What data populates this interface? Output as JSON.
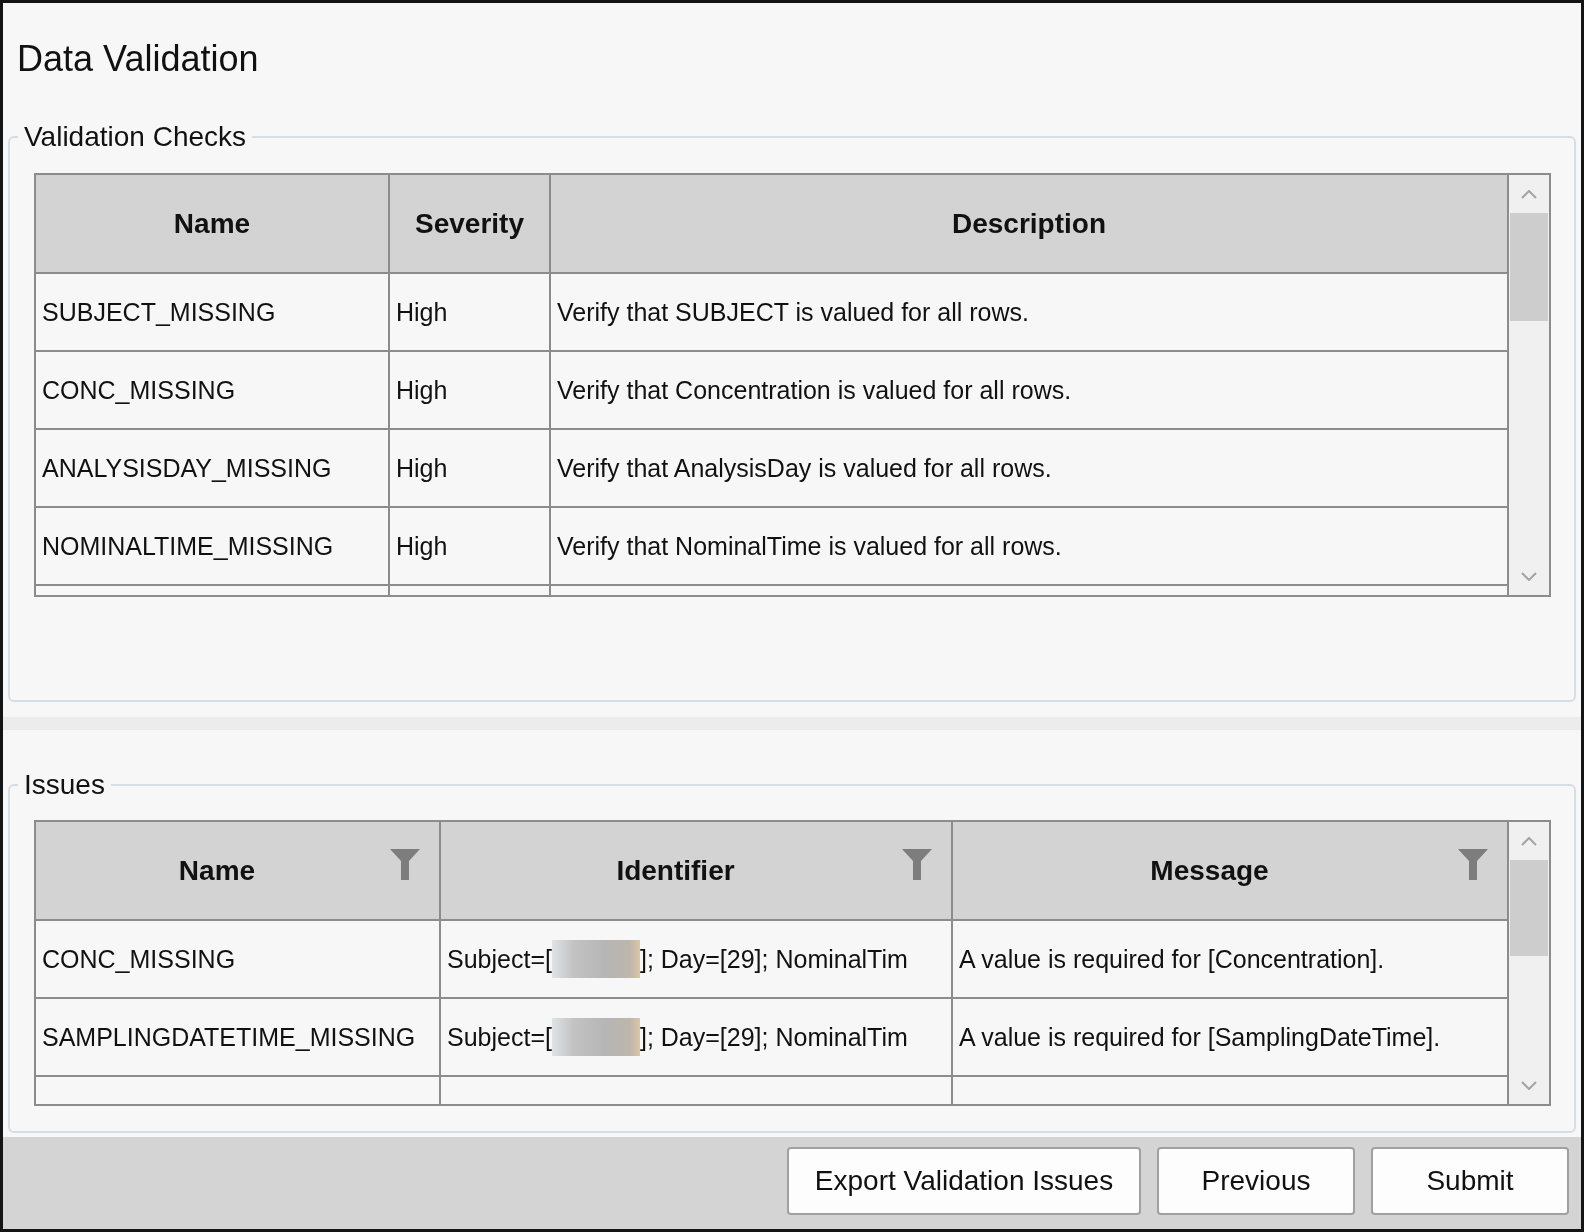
{
  "window": {
    "title": "Data Validation"
  },
  "validation_checks": {
    "title": "Validation Checks",
    "columns": [
      {
        "label": "Name"
      },
      {
        "label": "Severity"
      },
      {
        "label": "Description"
      }
    ],
    "rows": [
      {
        "name": "SUBJECT_MISSING",
        "severity": "High",
        "description": "Verify that SUBJECT is valued for all rows."
      },
      {
        "name": "CONC_MISSING",
        "severity": "High",
        "description": "Verify that Concentration is valued for all rows."
      },
      {
        "name": "ANALYSISDAY_MISSING",
        "severity": "High",
        "description": "Verify that AnalysisDay is valued for all rows."
      },
      {
        "name": "NOMINALTIME_MISSING",
        "severity": "High",
        "description": "Verify that NominalTime is valued for all rows."
      }
    ]
  },
  "issues": {
    "title": "Issues",
    "columns": [
      {
        "label": "Name",
        "filter": true
      },
      {
        "label": "Identifier",
        "filter": true
      },
      {
        "label": "Message",
        "filter": true
      }
    ],
    "rows": [
      {
        "name": "CONC_MISSING",
        "identifier": {
          "prefix": "Subject=[",
          "redacted": true,
          "suffix": "]; Day=[29]; NominalTim"
        },
        "message": "A value is required for [Concentration]."
      },
      {
        "name": "SAMPLINGDATETIME_MISSING",
        "identifier": {
          "prefix": "Subject=[",
          "redacted": true,
          "suffix": "]; Day=[29]; NominalTim"
        },
        "message": "A value is required for [SamplingDateTime]."
      }
    ]
  },
  "buttons": [
    {
      "label": "Export Validation Issues"
    },
    {
      "label": "Previous"
    },
    {
      "label": "Submit"
    }
  ]
}
